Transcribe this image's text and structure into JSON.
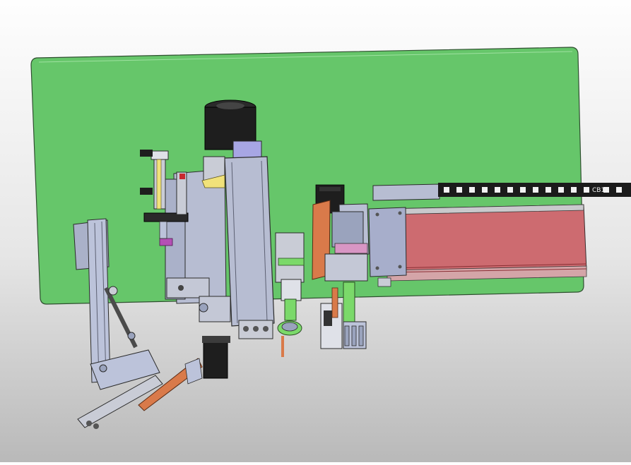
{
  "viewport": {
    "background_top": "#fefefe",
    "background_bottom": "#b9b9b9"
  },
  "model": {
    "base_plate_color": "#66c66a",
    "linear_module_color": "#cd6b70",
    "motor_color": "#1e1e1e",
    "bracket_color": "#9aa3bd",
    "accent_orange": "#d97a4a",
    "accent_green": "#7bd96a",
    "accent_magenta": "#b44fb4",
    "accent_yellow": "#f1e27a",
    "cable_chain_label": "CB1"
  }
}
